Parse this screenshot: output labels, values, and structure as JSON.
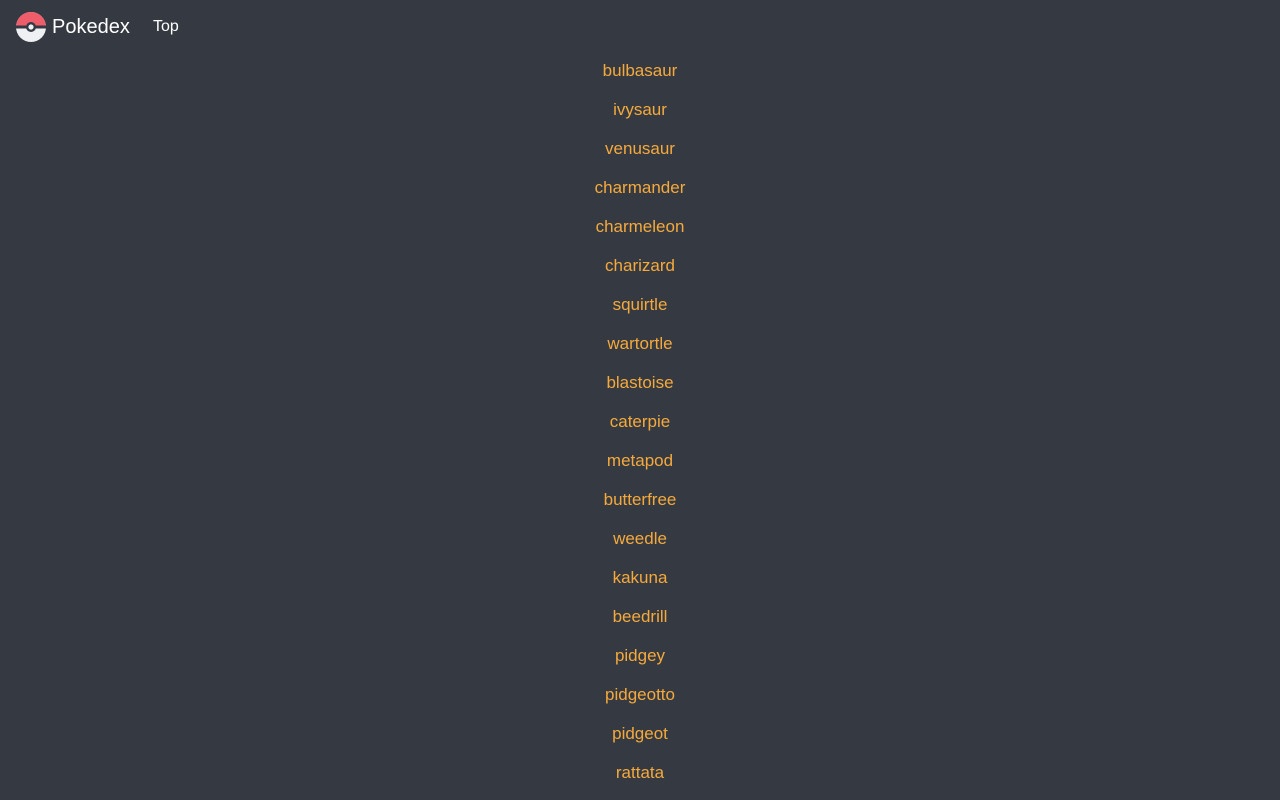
{
  "header": {
    "brand": "Pokedex",
    "nav_link": "Top",
    "logo_icon": "pokeball-icon"
  },
  "colors": {
    "background": "#353a42",
    "link": "#f5a93c",
    "header_text": "#ffffff",
    "pokeball_red": "#ef5c6a",
    "pokeball_white": "#eef0f3",
    "pokeball_band": "#353a42"
  },
  "pokemon": [
    "bulbasaur",
    "ivysaur",
    "venusaur",
    "charmander",
    "charmeleon",
    "charizard",
    "squirtle",
    "wartortle",
    "blastoise",
    "caterpie",
    "metapod",
    "butterfree",
    "weedle",
    "kakuna",
    "beedrill",
    "pidgey",
    "pidgeotto",
    "pidgeot",
    "rattata"
  ]
}
